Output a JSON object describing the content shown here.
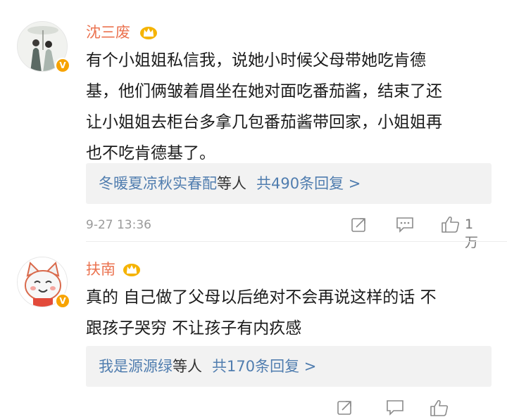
{
  "comments": [
    {
      "username": "沈三废",
      "text": "有个小姐姐私信我，说她小时候父母带她吃肯德\n基，他们俩皱着眉坐在她对面吃番茄酱，结束了还\n让小姐姐去柜台多拿几包番茄酱带回家，小姐姐再\n也不吃肯德基了。",
      "reply_users": "冬暖夏凉秋实春配",
      "reply_suffix": "等人",
      "reply_count": "共490条回复 >",
      "time": "9-27 13:36",
      "like_count": "1万"
    },
    {
      "username": "扶南",
      "text": "真的 自己做了父母以后绝对不会再说这样的话 不\n跟孩子哭穷 不让孩子有内疚感",
      "reply_users": "我是源源绿",
      "reply_suffix": "等人",
      "reply_count": "共170条回复 >",
      "time": "",
      "like_count": ""
    }
  ],
  "colors": {
    "username": "#eb7350",
    "link": "#507daf",
    "badge": "#f7a300",
    "meta": "#9a9a9a",
    "reply_bg": "#f2f2f2"
  },
  "icons": {
    "verified_badge": "V",
    "crown": "crown-icon",
    "forward": "forward-icon",
    "comment": "comment-icon",
    "like": "thumbs-up-icon"
  }
}
